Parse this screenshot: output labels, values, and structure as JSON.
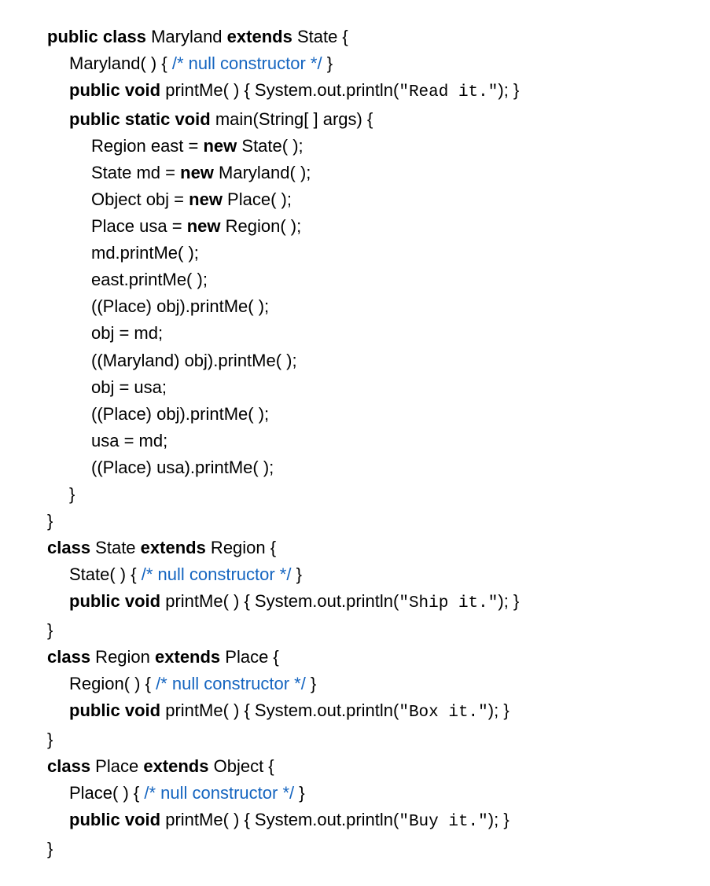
{
  "code": {
    "l1": {
      "a": "public class",
      "b": " Maryland ",
      "c": "extends",
      "d": " State {"
    },
    "l2": {
      "a": "Maryland( ) { ",
      "b": "/* null constructor */",
      "c": " }"
    },
    "l3": {
      "a": "public void",
      "b": " printMe( ) { System.out.println(",
      "c": "\"Read it.\"",
      "d": "); }"
    },
    "l4": {
      "a": "public static void",
      "b": " main(String[ ] args) {"
    },
    "l5": {
      "a": "Region east = ",
      "b": "new",
      "c": " State( );"
    },
    "l6": {
      "a": "State md = ",
      "b": "new",
      "c": " Maryland( );"
    },
    "l7": {
      "a": "Object obj = ",
      "b": "new",
      "c": " Place( );"
    },
    "l8": {
      "a": "Place usa = ",
      "b": "new",
      "c": " Region( );"
    },
    "l9": {
      "a": "md.printMe( );"
    },
    "l10": {
      "a": "east.printMe( );"
    },
    "l11": {
      "a": "((Place) obj).printMe( );"
    },
    "l12": {
      "a": "obj = md;"
    },
    "l13": {
      "a": "((Maryland) obj).printMe( );"
    },
    "l14": {
      "a": "obj = usa;"
    },
    "l15": {
      "a": "((Place) obj).printMe( );"
    },
    "l16": {
      "a": "usa = md;"
    },
    "l17": {
      "a": "((Place) usa).printMe( );"
    },
    "l18": {
      "a": "}"
    },
    "l19": {
      "a": "}"
    },
    "l20": {
      "a": "class",
      "b": " State ",
      "c": "extends",
      "d": " Region {"
    },
    "l21": {
      "a": "State( ) { ",
      "b": "/* null constructor */",
      "c": " }"
    },
    "l22": {
      "a": "public void",
      "b": " printMe( ) { System.out.println(",
      "c": "\"Ship it.\"",
      "d": "); }"
    },
    "l23": {
      "a": "}"
    },
    "l24": {
      "a": "class",
      "b": " Region ",
      "c": "extends",
      "d": " Place {"
    },
    "l25": {
      "a": "Region( ) { ",
      "b": "/* null constructor */",
      "c": " }"
    },
    "l26": {
      "a": "public void",
      "b": " printMe( ) { System.out.println(",
      "c": "\"Box it.\"",
      "d": "); }"
    },
    "l27": {
      "a": "}"
    },
    "l28": {
      "a": "class",
      "b": " Place ",
      "c": "extends",
      "d": " Object {"
    },
    "l29": {
      "a": "Place( ) { ",
      "b": "/* null constructor */",
      "c": " }"
    },
    "l30": {
      "a": "public void",
      "b": " printMe( ) { System.out.println(",
      "c": "\"Buy it.\"",
      "d": "); }"
    },
    "l31": {
      "a": "}"
    }
  }
}
